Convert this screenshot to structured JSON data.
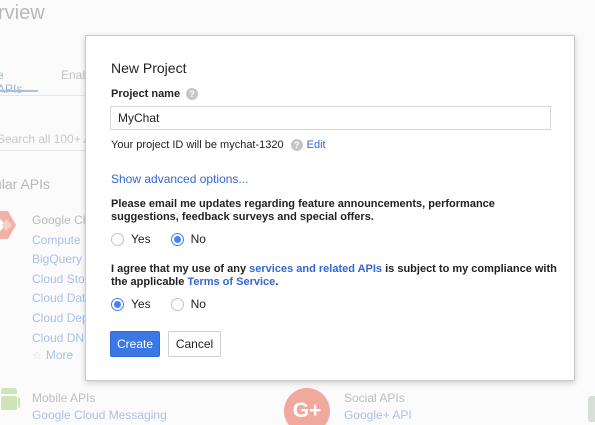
{
  "background": {
    "title": "rview",
    "tabs": [
      "e APIs",
      "Enab"
    ],
    "search_placeholder": "Search all 100+ A",
    "section_title": "ular APIs",
    "cloud_group": {
      "heading": "Google Cl",
      "items": [
        "Compute",
        "BigQuery",
        "Cloud Stor",
        "Cloud Dat",
        "Cloud Dep",
        "Cloud DNS"
      ],
      "more": "More"
    },
    "mobile": {
      "title": "Mobile APIs",
      "link": "Google Cloud Messaging"
    },
    "social": {
      "title": "Social APIs",
      "link": "Google+ API"
    },
    "gplus_glyph": "G+"
  },
  "dialog": {
    "title": "New Project",
    "project_name_label": "Project name",
    "help_glyph": "?",
    "project_name_value": "MyChat",
    "project_id_text": "Your project ID will be mychat-1320",
    "edit_label": "Edit",
    "advanced_link": "Show advanced options...",
    "email_question": "Please email me updates regarding feature announcements, performance suggestions, feedback surveys and special offers.",
    "email_options": [
      {
        "label": "Yes",
        "selected": false
      },
      {
        "label": "No",
        "selected": true
      }
    ],
    "terms": {
      "part1": "I agree that my use of any ",
      "link1": "services and related APIs",
      "part2": " is subject to my compliance with the applicable ",
      "link2": "Terms of Service",
      "part3": "."
    },
    "terms_options": [
      {
        "label": "Yes",
        "selected": true
      },
      {
        "label": "No",
        "selected": false
      }
    ],
    "create_label": "Create",
    "cancel_label": "Cancel"
  },
  "colors": {
    "accent": "#3b78e7",
    "link": "#3367d6",
    "radio_selected": "#4285f4"
  }
}
